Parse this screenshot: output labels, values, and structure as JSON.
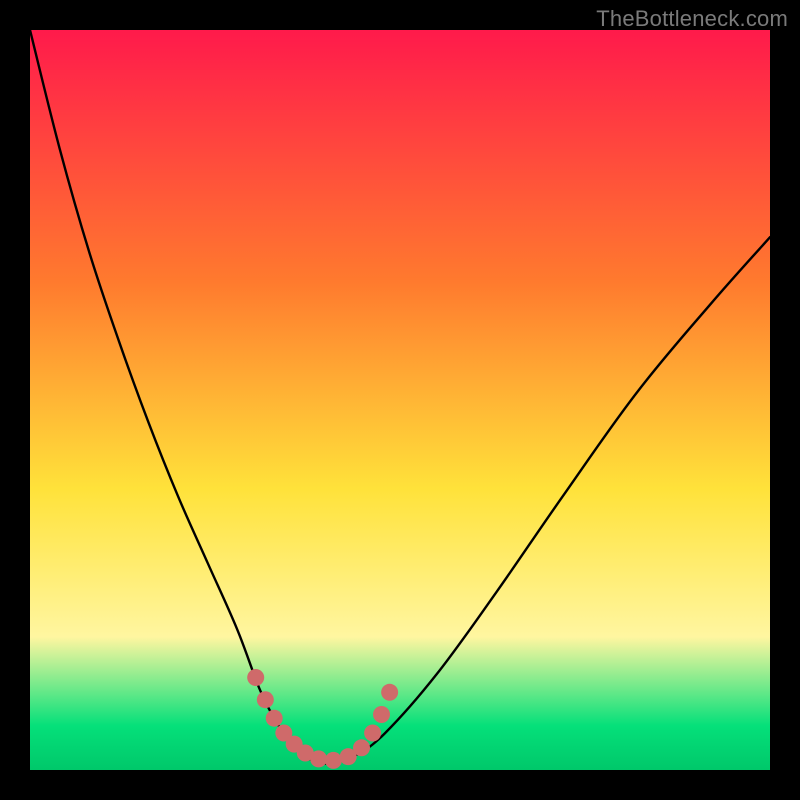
{
  "watermark": "TheBottleneck.com",
  "chart_data": {
    "type": "line",
    "title": "",
    "xlabel": "",
    "ylabel": "",
    "xlim": [
      0,
      100
    ],
    "ylim": [
      0,
      100
    ],
    "gradient_colors": {
      "top": "#ff1a4b",
      "upper_mid": "#ff7a2e",
      "mid": "#ffe23a",
      "lower_mid": "#fff6a0",
      "bottom_band": "#05e07a",
      "bottom_edge": "#00c86a"
    },
    "curve_stroke": "#000000",
    "marker_color": "#cf6a6a",
    "series": [
      {
        "name": "bottleneck-curve",
        "x": [
          0,
          4,
          8,
          12,
          16,
          20,
          24,
          28,
          31,
          33,
          35,
          37,
          39,
          41,
          44,
          48,
          55,
          63,
          72,
          82,
          92,
          100
        ],
        "y": [
          100,
          84,
          70,
          58,
          47,
          37,
          28,
          19,
          11,
          7,
          4,
          2,
          1,
          1,
          2,
          5,
          13,
          24,
          37,
          51,
          63,
          72
        ]
      }
    ],
    "markers": {
      "name": "highlight-points",
      "x": [
        30.5,
        31.8,
        33.0,
        34.3,
        35.7,
        37.2,
        39.0,
        41.0,
        43.0,
        44.8,
        46.3,
        47.5,
        48.6
      ],
      "y": [
        12.5,
        9.5,
        7.0,
        5.0,
        3.5,
        2.3,
        1.5,
        1.3,
        1.8,
        3.0,
        5.0,
        7.5,
        10.5
      ]
    }
  }
}
